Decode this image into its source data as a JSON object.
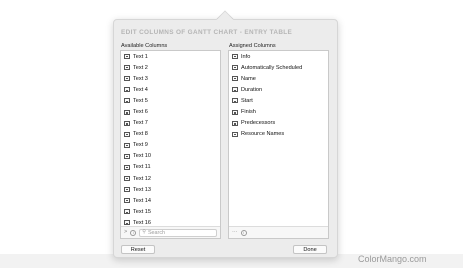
{
  "dialog": {
    "title": "EDIT COLUMNS OF GANTT CHART - ENTRY TABLE",
    "available_label": "Available Columns",
    "assigned_label": "Assigned Columns",
    "available_items": [
      "Text 1",
      "Text 2",
      "Text 3",
      "Text 4",
      "Text 5",
      "Text 6",
      "Text 7",
      "Text 8",
      "Text 9",
      "Text 10",
      "Text 11",
      "Text 12",
      "Text 13",
      "Text 14",
      "Text 15",
      "Text 16"
    ],
    "assigned_items": [
      "Info",
      "Automatically Scheduled",
      "Name",
      "Duration",
      "Start",
      "Finish",
      "Predecessors",
      "Resource Names"
    ],
    "left_footer": {
      "expand_glyph": ">",
      "info_glyph": "i",
      "search_placeholder": "Search"
    },
    "right_footer": {
      "more_glyph": "···",
      "info_glyph": "i"
    },
    "reset_label": "Reset",
    "done_label": "Done"
  },
  "watermark": "ColorMango.com"
}
